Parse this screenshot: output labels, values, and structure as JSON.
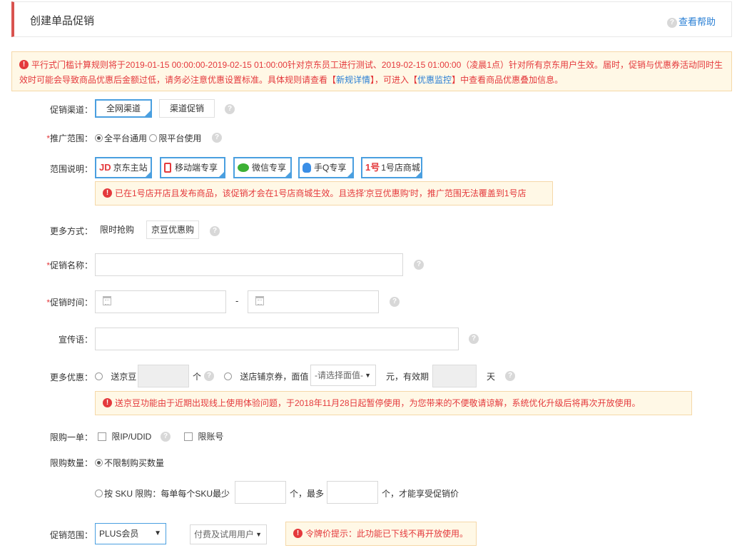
{
  "header": {
    "title": "创建单品促销",
    "help": "查看帮助"
  },
  "notice": {
    "part1": "平行式门槛计算规则将于2019-01-15 00:00:00-2019-02-15 01:00:00针对京东员工进行测试、2019-02-15 01:00:00（凌晨1点）针对所有京东用户生效。届时，促销与优惠券活动同时生效时可能会导致商品优惠后金额过低，请务必注意优惠设置标准。具体规则请查看【",
    "link1": "新规详情",
    "part2": "】，可进入【",
    "link2": "优惠监控",
    "part3": "】中查看商品优惠叠加信息。"
  },
  "channel": {
    "label": "促销渠道：",
    "options": [
      "全网渠道",
      "渠道促销"
    ]
  },
  "scope": {
    "label": "推广范围：",
    "options": [
      "全平台通用",
      "限平台使用"
    ]
  },
  "platform": {
    "label": "范围说明：",
    "items": [
      "京东主站",
      "移动端专享",
      "微信专享",
      "手Q专享",
      "1号店商城"
    ],
    "jd_logo": "JD",
    "one_logo": "1号",
    "warning": "已在1号店开店且发布商品，该促销才会在1号店商城生效。且选择'京豆优惠购'时，推广范围无法覆盖到1号店"
  },
  "more_methods": {
    "label": "更多方式：",
    "options": [
      "限时抢购",
      "京豆优惠购"
    ]
  },
  "name": {
    "label": "促销名称：",
    "value": ""
  },
  "time": {
    "label": "促销时间：",
    "dash": "-"
  },
  "slogan": {
    "label": "宣传语："
  },
  "more_discount": {
    "label": "更多优惠：",
    "bean": "送京豆",
    "unit": "个",
    "coupon": "送店铺京券，面值",
    "select": "-请选择面值-",
    "validity": "元，有效期",
    "day": "天",
    "warning": "送京豆功能由于近期出现线上使用体验问题，于2018年11月28日起暂停使用，为您带来的不便敬请谅解，系统优化升级后将再次开放使用。"
  },
  "limit_one": {
    "label": "限购一单：",
    "ip": "限IP/UDID",
    "account": "限账号"
  },
  "limit_qty": {
    "label": "限购数量：",
    "unlimited": "不限制购买数量",
    "by_sku": "按 SKU 限购：每单每个SKU最少",
    "unit1": "个，最多",
    "unit2": "个，才能享受促销价"
  },
  "promo_scope": {
    "label": "促销范围：",
    "member": "PLUS会员",
    "user_type": "付费及试用用户",
    "tip": "令牌价提示：此功能已下线不再开放使用。"
  },
  "colors": {
    "accent": "#4a9fe0",
    "error": "#e4393c",
    "link": "#2a7fd4",
    "header_bar": "#d9534f"
  }
}
